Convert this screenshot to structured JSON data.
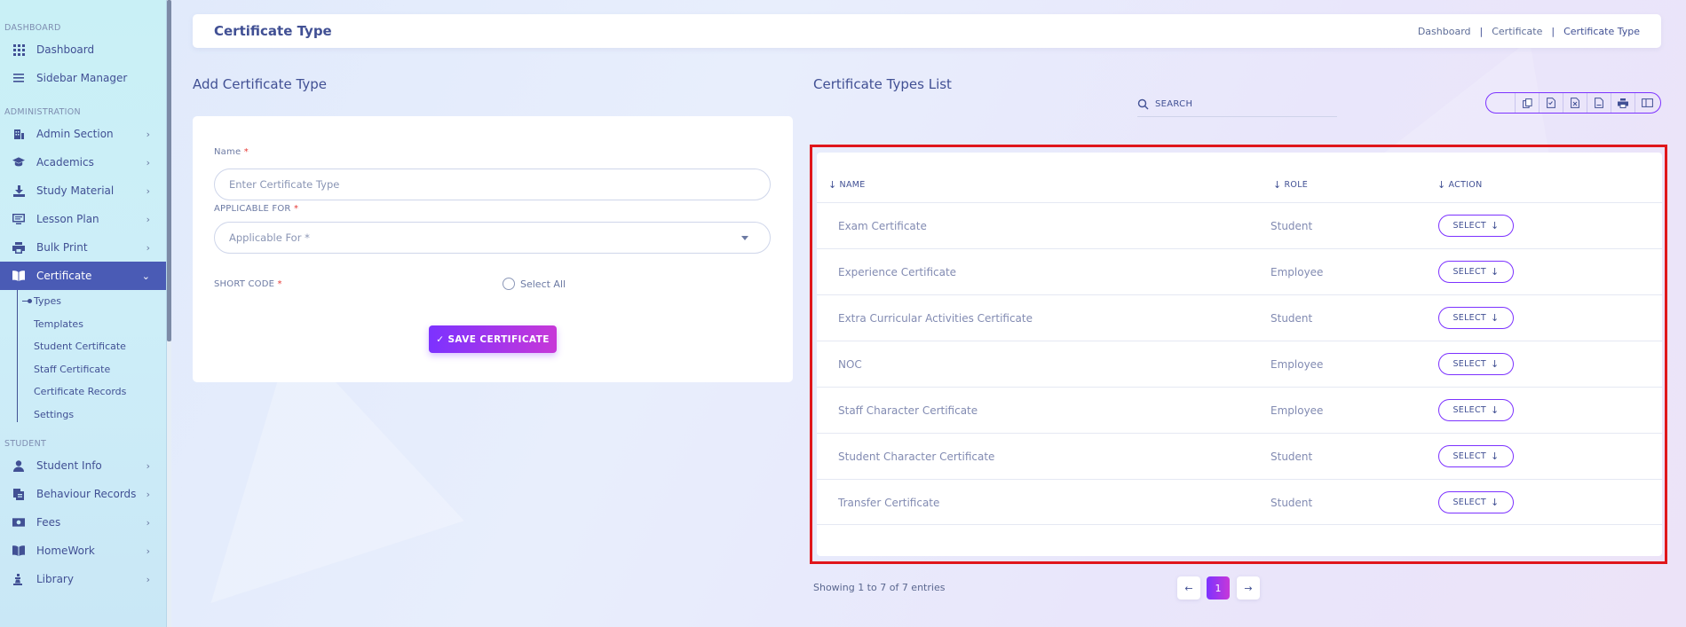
{
  "sidebar": {
    "sections": {
      "dashboard": "DASHBOARD",
      "administration": "ADMINISTRATION",
      "student": "STUDENT"
    },
    "items": [
      {
        "label": "Dashboard",
        "icon": "grid-icon"
      },
      {
        "label": "Sidebar Manager",
        "icon": "menu-icon"
      },
      {
        "label": "Admin Section",
        "icon": "building-icon"
      },
      {
        "label": "Academics",
        "icon": "graduation-cap-icon"
      },
      {
        "label": "Study Material",
        "icon": "download-icon"
      },
      {
        "label": "Lesson Plan",
        "icon": "monitor-icon"
      },
      {
        "label": "Bulk Print",
        "icon": "printer-icon"
      },
      {
        "label": "Certificate",
        "icon": "book-icon"
      },
      {
        "label": "Student Info",
        "icon": "user-icon"
      },
      {
        "label": "Behaviour Records",
        "icon": "records-icon"
      },
      {
        "label": "Fees",
        "icon": "money-icon"
      },
      {
        "label": "HomeWork",
        "icon": "book-open-icon"
      },
      {
        "label": "Library",
        "icon": "library-icon"
      }
    ],
    "certificate_sub": [
      "Types",
      "Templates",
      "Student Certificate",
      "Staff Certificate",
      "Certificate Records",
      "Settings"
    ]
  },
  "header": {
    "title": "Certificate Type",
    "breadcrumb": [
      "Dashboard",
      "Certificate",
      "Certificate Type"
    ],
    "separator": "|"
  },
  "form": {
    "heading": "Add Certificate Type",
    "name_label": "Name",
    "required_mark": "*",
    "name_placeholder": "Enter Certificate Type",
    "applicable_label": "APPLICABLE FOR",
    "applicable_value": "Applicable For *",
    "short_code_label": "SHORT CODE",
    "select_all_label": "Select All",
    "save_label": "✓ SAVE CERTIFICATE"
  },
  "list": {
    "heading": "Certificate Types List",
    "search_placeholder": "SEARCH",
    "toolbar_icons": [
      "copy-icon",
      "csv-icon",
      "excel-icon",
      "pdf-icon",
      "print-icon",
      "columns-icon"
    ],
    "columns": [
      "NAME",
      "ROLE",
      "ACTION"
    ],
    "rows": [
      {
        "name": "Exam Certificate",
        "role": "Student",
        "action": "SELECT"
      },
      {
        "name": "Experience Certificate",
        "role": "Employee",
        "action": "SELECT"
      },
      {
        "name": "Extra Curricular Activities Certificate",
        "role": "Student",
        "action": "SELECT"
      },
      {
        "name": "NOC",
        "role": "Employee",
        "action": "SELECT"
      },
      {
        "name": "Staff Character Certificate",
        "role": "Employee",
        "action": "SELECT"
      },
      {
        "name": "Student Character Certificate",
        "role": "Student",
        "action": "SELECT"
      },
      {
        "name": "Transfer Certificate",
        "role": "Student",
        "action": "SELECT"
      }
    ],
    "showing": "Showing 1 to 7 of 7 entries",
    "pagination": {
      "prev": "←",
      "current": "1",
      "next": "→"
    }
  },
  "colors": {
    "primary": "#415094",
    "accent": "#7c32ff",
    "accent_end": "#c738d8",
    "highlight": "#e0161b",
    "active_sidebar": "#4a5bb5"
  }
}
